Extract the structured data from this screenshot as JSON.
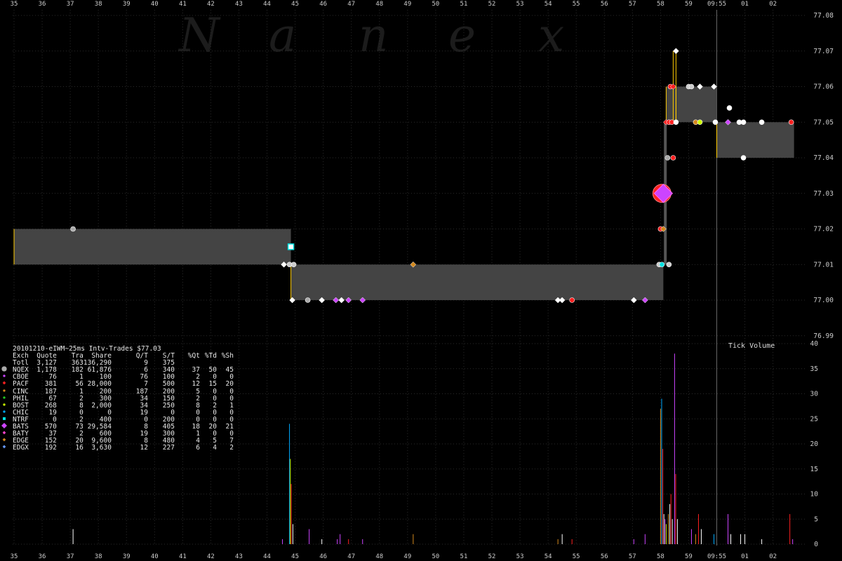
{
  "watermark": "Nanex",
  "chart_data": {
    "type": "scatter",
    "title": "20101210-eIWM~25ms Intv-Trades $77.03",
    "x_tick_labels_top": [
      "35",
      "36",
      "37",
      "38",
      "39",
      "40",
      "41",
      "42",
      "43",
      "44",
      "45",
      "46",
      "47",
      "48",
      "49",
      "50",
      "51",
      "52",
      "53",
      "54",
      "55",
      "56",
      "57",
      "58",
      "59",
      "09:55",
      "01",
      "02"
    ],
    "x_tick_labels_bottom": [
      "35",
      "36",
      "37",
      "38",
      "39",
      "40",
      "41",
      "42",
      "43",
      "44",
      "45",
      "46",
      "47",
      "48",
      "49",
      "50",
      "51",
      "52",
      "53",
      "54",
      "55",
      "56",
      "57",
      "58",
      "59",
      "09:55",
      "01",
      "02"
    ],
    "price_axis": {
      "labels": [
        "77.08",
        "77.07",
        "77.06",
        "77.05",
        "77.04",
        "77.03",
        "77.02",
        "77.01",
        "77.00",
        "76.99"
      ],
      "ylim": [
        76.99,
        77.08
      ]
    },
    "volume_axis": {
      "title": "Tick Volume",
      "labels": [
        "40",
        "35",
        "30",
        "25",
        "20",
        "15",
        "10",
        "5",
        "0"
      ],
      "ylim": [
        0,
        40
      ]
    },
    "nbbo_bands": [
      {
        "x0": 35.0,
        "x1": 44.85,
        "bid": 77.01,
        "ask": 77.02
      },
      {
        "x0": 44.85,
        "x1": 58.1,
        "bid": 77.0,
        "ask": 77.01
      },
      {
        "x0": 58.2,
        "x1": 58.55,
        "bid": 77.05,
        "ask": 77.06
      },
      {
        "x0": 58.55,
        "x1": 60.0,
        "bid": 77.05,
        "ask": 77.06
      },
      {
        "x0": 60.0,
        "x1": 62.75,
        "bid": 77.04,
        "ask": 77.05
      }
    ],
    "trades": [
      {
        "x": 37.1,
        "p": 77.02,
        "c": "#aaaaaa",
        "s": "circle"
      },
      {
        "x": 44.6,
        "p": 77.01,
        "c": "#ffffff",
        "s": "diamond"
      },
      {
        "x": 44.8,
        "p": 77.01,
        "c": "#cccccc",
        "s": "circle"
      },
      {
        "x": 44.95,
        "p": 77.01,
        "c": "#cccccc",
        "s": "circle"
      },
      {
        "x": 44.85,
        "p": 77.015,
        "c": "#00e0e0",
        "s": "square"
      },
      {
        "x": 44.9,
        "p": 77.0,
        "c": "#ffffff",
        "s": "diamond"
      },
      {
        "x": 45.45,
        "p": 77.0,
        "c": "#aaaaaa",
        "s": "circle"
      },
      {
        "x": 45.95,
        "p": 77.0,
        "c": "#ffffff",
        "s": "diamond"
      },
      {
        "x": 46.45,
        "p": 77.0,
        "c": "#cc44ff",
        "s": "diamond"
      },
      {
        "x": 46.65,
        "p": 77.0,
        "c": "#ffffff",
        "s": "diamond"
      },
      {
        "x": 46.9,
        "p": 77.0,
        "c": "#cc44ff",
        "s": "diamond"
      },
      {
        "x": 47.4,
        "p": 77.0,
        "c": "#cc44ff",
        "s": "diamond"
      },
      {
        "x": 49.2,
        "p": 77.01,
        "c": "#d4881c",
        "s": "diamond"
      },
      {
        "x": 54.35,
        "p": 77.0,
        "c": "#ffffff",
        "s": "diamond"
      },
      {
        "x": 54.5,
        "p": 77.0,
        "c": "#ffffff",
        "s": "diamond"
      },
      {
        "x": 54.85,
        "p": 77.0,
        "c": "#ff2020",
        "s": "circle"
      },
      {
        "x": 57.05,
        "p": 77.0,
        "c": "#ffffff",
        "s": "diamond"
      },
      {
        "x": 57.45,
        "p": 77.0,
        "c": "#cc44ff",
        "s": "diamond"
      },
      {
        "x": 57.95,
        "p": 77.01,
        "c": "#cccccc",
        "s": "circle"
      },
      {
        "x": 58.05,
        "p": 77.01,
        "c": "#00e0e0",
        "s": "circle"
      },
      {
        "x": 58.3,
        "p": 77.01,
        "c": "#cccccc",
        "s": "circle"
      },
      {
        "x": 58.0,
        "p": 77.02,
        "c": "#ff2020",
        "s": "circle"
      },
      {
        "x": 58.1,
        "p": 77.02,
        "c": "#d4881c",
        "s": "diamond"
      },
      {
        "x": 58.05,
        "p": 77.03,
        "c": "#ff2020",
        "s": "bigcircle"
      },
      {
        "x": 58.1,
        "p": 77.03,
        "c": "#cc44ff",
        "s": "bigdiamond"
      },
      {
        "x": 58.25,
        "p": 77.04,
        "c": "#aaaaaa",
        "s": "circle"
      },
      {
        "x": 58.45,
        "p": 77.04,
        "c": "#ff2020",
        "s": "circle"
      },
      {
        "x": 58.2,
        "p": 77.05,
        "c": "#ff2020",
        "s": "diamond"
      },
      {
        "x": 58.3,
        "p": 77.05,
        "c": "#ff2020",
        "s": "circle"
      },
      {
        "x": 58.4,
        "p": 77.05,
        "c": "#ff2020",
        "s": "circle"
      },
      {
        "x": 58.55,
        "p": 77.05,
        "c": "#ffffff",
        "s": "circle"
      },
      {
        "x": 58.35,
        "p": 77.06,
        "c": "#ff2020",
        "s": "circle"
      },
      {
        "x": 58.45,
        "p": 77.06,
        "c": "#ff2020",
        "s": "diamond"
      },
      {
        "x": 58.55,
        "p": 77.07,
        "c": "#ffffff",
        "s": "diamond"
      },
      {
        "x": 59.0,
        "p": 77.06,
        "c": "#cccccc",
        "s": "circle"
      },
      {
        "x": 59.1,
        "p": 77.06,
        "c": "#cccccc",
        "s": "circle"
      },
      {
        "x": 59.4,
        "p": 77.06,
        "c": "#ffffff",
        "s": "diamond"
      },
      {
        "x": 59.9,
        "p": 77.06,
        "c": "#ffffff",
        "s": "diamond"
      },
      {
        "x": 59.25,
        "p": 77.05,
        "c": "#d4881c",
        "s": "circle"
      },
      {
        "x": 59.4,
        "p": 77.05,
        "c": "#ccff00",
        "s": "circle"
      },
      {
        "x": 59.95,
        "p": 77.05,
        "c": "#ffffff",
        "s": "circle"
      },
      {
        "x": 60.4,
        "p": 77.05,
        "c": "#cc44ff",
        "s": "diamond"
      },
      {
        "x": 60.45,
        "p": 77.054,
        "c": "#ffffff",
        "s": "circle"
      },
      {
        "x": 60.8,
        "p": 77.05,
        "c": "#ffffff",
        "s": "circle"
      },
      {
        "x": 60.95,
        "p": 77.05,
        "c": "#ffffff",
        "s": "circle"
      },
      {
        "x": 61.6,
        "p": 77.05,
        "c": "#ffffff",
        "s": "circle"
      },
      {
        "x": 62.65,
        "p": 77.05,
        "c": "#ff2020",
        "s": "circle"
      },
      {
        "x": 60.95,
        "p": 77.04,
        "c": "#ffffff",
        "s": "circle"
      }
    ],
    "volume_bars": [
      {
        "x": 37.1,
        "v": 3,
        "c": "#ffffff"
      },
      {
        "x": 44.55,
        "v": 1,
        "c": "#cc44ff"
      },
      {
        "x": 44.8,
        "v": 24,
        "c": "#00aaff"
      },
      {
        "x": 44.83,
        "v": 17,
        "c": "#ccff00"
      },
      {
        "x": 44.86,
        "v": 12,
        "c": "#ff2020"
      },
      {
        "x": 44.92,
        "v": 4,
        "c": "#ffffff"
      },
      {
        "x": 45.5,
        "v": 3,
        "c": "#cc44ff"
      },
      {
        "x": 45.95,
        "v": 1,
        "c": "#ffffff"
      },
      {
        "x": 46.5,
        "v": 1,
        "c": "#cc44ff"
      },
      {
        "x": 46.6,
        "v": 2,
        "c": "#cc44ff"
      },
      {
        "x": 46.9,
        "v": 1,
        "c": "#ff2020"
      },
      {
        "x": 47.4,
        "v": 1,
        "c": "#cc44ff"
      },
      {
        "x": 49.2,
        "v": 2,
        "c": "#d4881c"
      },
      {
        "x": 54.35,
        "v": 1,
        "c": "#d4881c"
      },
      {
        "x": 54.5,
        "v": 2,
        "c": "#ffffff"
      },
      {
        "x": 54.85,
        "v": 1,
        "c": "#ff2020"
      },
      {
        "x": 57.05,
        "v": 1,
        "c": "#cc44ff"
      },
      {
        "x": 57.45,
        "v": 2,
        "c": "#cc44ff"
      },
      {
        "x": 58.0,
        "v": 27,
        "c": "#d4881c"
      },
      {
        "x": 58.04,
        "v": 29,
        "c": "#00aaff"
      },
      {
        "x": 58.08,
        "v": 19,
        "c": "#ff2020"
      },
      {
        "x": 58.12,
        "v": 6,
        "c": "#ffffff"
      },
      {
        "x": 58.16,
        "v": 5,
        "c": "#cc44ff"
      },
      {
        "x": 58.2,
        "v": 4,
        "c": "#ccff00"
      },
      {
        "x": 58.28,
        "v": 6,
        "c": "#d4881c"
      },
      {
        "x": 58.33,
        "v": 8,
        "c": "#ffffff"
      },
      {
        "x": 58.37,
        "v": 10,
        "c": "#ff2020"
      },
      {
        "x": 58.42,
        "v": 5,
        "c": "#ffffff"
      },
      {
        "x": 58.5,
        "v": 38,
        "c": "#cc44ff"
      },
      {
        "x": 58.54,
        "v": 14,
        "c": "#ff2020"
      },
      {
        "x": 58.6,
        "v": 5,
        "c": "#ffffff"
      },
      {
        "x": 59.1,
        "v": 3,
        "c": "#cc44ff"
      },
      {
        "x": 59.25,
        "v": 2,
        "c": "#d4881c"
      },
      {
        "x": 59.35,
        "v": 6,
        "c": "#ff2020"
      },
      {
        "x": 59.45,
        "v": 3,
        "c": "#ffffff"
      },
      {
        "x": 59.9,
        "v": 2,
        "c": "#00aaff"
      },
      {
        "x": 60.4,
        "v": 6,
        "c": "#cc44ff"
      },
      {
        "x": 60.5,
        "v": 2,
        "c": "#ffffff"
      },
      {
        "x": 60.85,
        "v": 2,
        "c": "#ffffff"
      },
      {
        "x": 61.0,
        "v": 2,
        "c": "#ffffff"
      },
      {
        "x": 61.6,
        "v": 1,
        "c": "#ffffff"
      },
      {
        "x": 62.6,
        "v": 6,
        "c": "#ff2020"
      },
      {
        "x": 62.7,
        "v": 1,
        "c": "#cc44ff"
      }
    ]
  },
  "stats": {
    "title": "20101210-eIWM~25ms Intv-Trades $77.03",
    "headers": [
      "Exch",
      "Quote",
      "Tra",
      "Share",
      "Q/T",
      "S/T",
      "%Qt",
      "%Td",
      "%Sh"
    ],
    "rows": [
      {
        "exch": "Totl",
        "quote": "3,127",
        "tra": "363",
        "share": "136,290",
        "qt": "9",
        "st": "375",
        "pqt": "",
        "ptd": "",
        "psh": "",
        "color": "",
        "marker": ""
      },
      {
        "exch": "NQEX",
        "quote": "1,178",
        "tra": "182",
        "share": "61,876",
        "qt": "6",
        "st": "340",
        "pqt": "37",
        "ptd": "50",
        "psh": "45",
        "color": "#aaaaaa",
        "marker": "bigcircle"
      },
      {
        "exch": "CBOE",
        "quote": "76",
        "tra": "1",
        "share": "100",
        "qt": "76",
        "st": "100",
        "pqt": "2",
        "ptd": "0",
        "psh": "0",
        "color": "#cc44ff",
        "marker": "circle"
      },
      {
        "exch": "PACF",
        "quote": "381",
        "tra": "56",
        "share": "28,000",
        "qt": "7",
        "st": "500",
        "pqt": "12",
        "ptd": "15",
        "psh": "20",
        "color": "#ff2020",
        "marker": "diamond"
      },
      {
        "exch": "CINC",
        "quote": "187",
        "tra": "1",
        "share": "200",
        "qt": "187",
        "st": "200",
        "pqt": "5",
        "ptd": "0",
        "psh": "0",
        "color": "#d4881c",
        "marker": "circle"
      },
      {
        "exch": "PHIL",
        "quote": "67",
        "tra": "2",
        "share": "300",
        "qt": "34",
        "st": "150",
        "pqt": "2",
        "ptd": "0",
        "psh": "0",
        "color": "#22cc22",
        "marker": "circle"
      },
      {
        "exch": "BOST",
        "quote": "268",
        "tra": "8",
        "share": "2,000",
        "qt": "34",
        "st": "250",
        "pqt": "8",
        "ptd": "2",
        "psh": "1",
        "color": "#ccff00",
        "marker": "circle"
      },
      {
        "exch": "CHIC",
        "quote": "19",
        "tra": "0",
        "share": "0",
        "qt": "19",
        "st": "0",
        "pqt": "0",
        "ptd": "0",
        "psh": "0",
        "color": "#00aaff",
        "marker": "circle"
      },
      {
        "exch": "NTRF",
        "quote": "0",
        "tra": "2",
        "share": "400",
        "qt": "0",
        "st": "200",
        "pqt": "0",
        "ptd": "0",
        "psh": "0",
        "color": "#00e0e0",
        "marker": "square"
      },
      {
        "exch": "BATS",
        "quote": "570",
        "tra": "73",
        "share": "29,584",
        "qt": "8",
        "st": "405",
        "pqt": "18",
        "ptd": "20",
        "psh": "21",
        "color": "#cc44ff",
        "marker": "bigdiamond"
      },
      {
        "exch": "BATY",
        "quote": "37",
        "tra": "2",
        "share": "600",
        "qt": "19",
        "st": "300",
        "pqt": "1",
        "ptd": "0",
        "psh": "0",
        "color": "#ff44cc",
        "marker": "diamond"
      },
      {
        "exch": "EDGE",
        "quote": "152",
        "tra": "20",
        "share": "9,600",
        "qt": "8",
        "st": "480",
        "pqt": "4",
        "ptd": "5",
        "psh": "7",
        "color": "#d4881c",
        "marker": "diamond"
      },
      {
        "exch": "EDGX",
        "quote": "192",
        "tra": "16",
        "share": "3,630",
        "qt": "12",
        "st": "227",
        "pqt": "6",
        "ptd": "4",
        "psh": "2",
        "color": "#6699ff",
        "marker": "diamond"
      }
    ]
  }
}
